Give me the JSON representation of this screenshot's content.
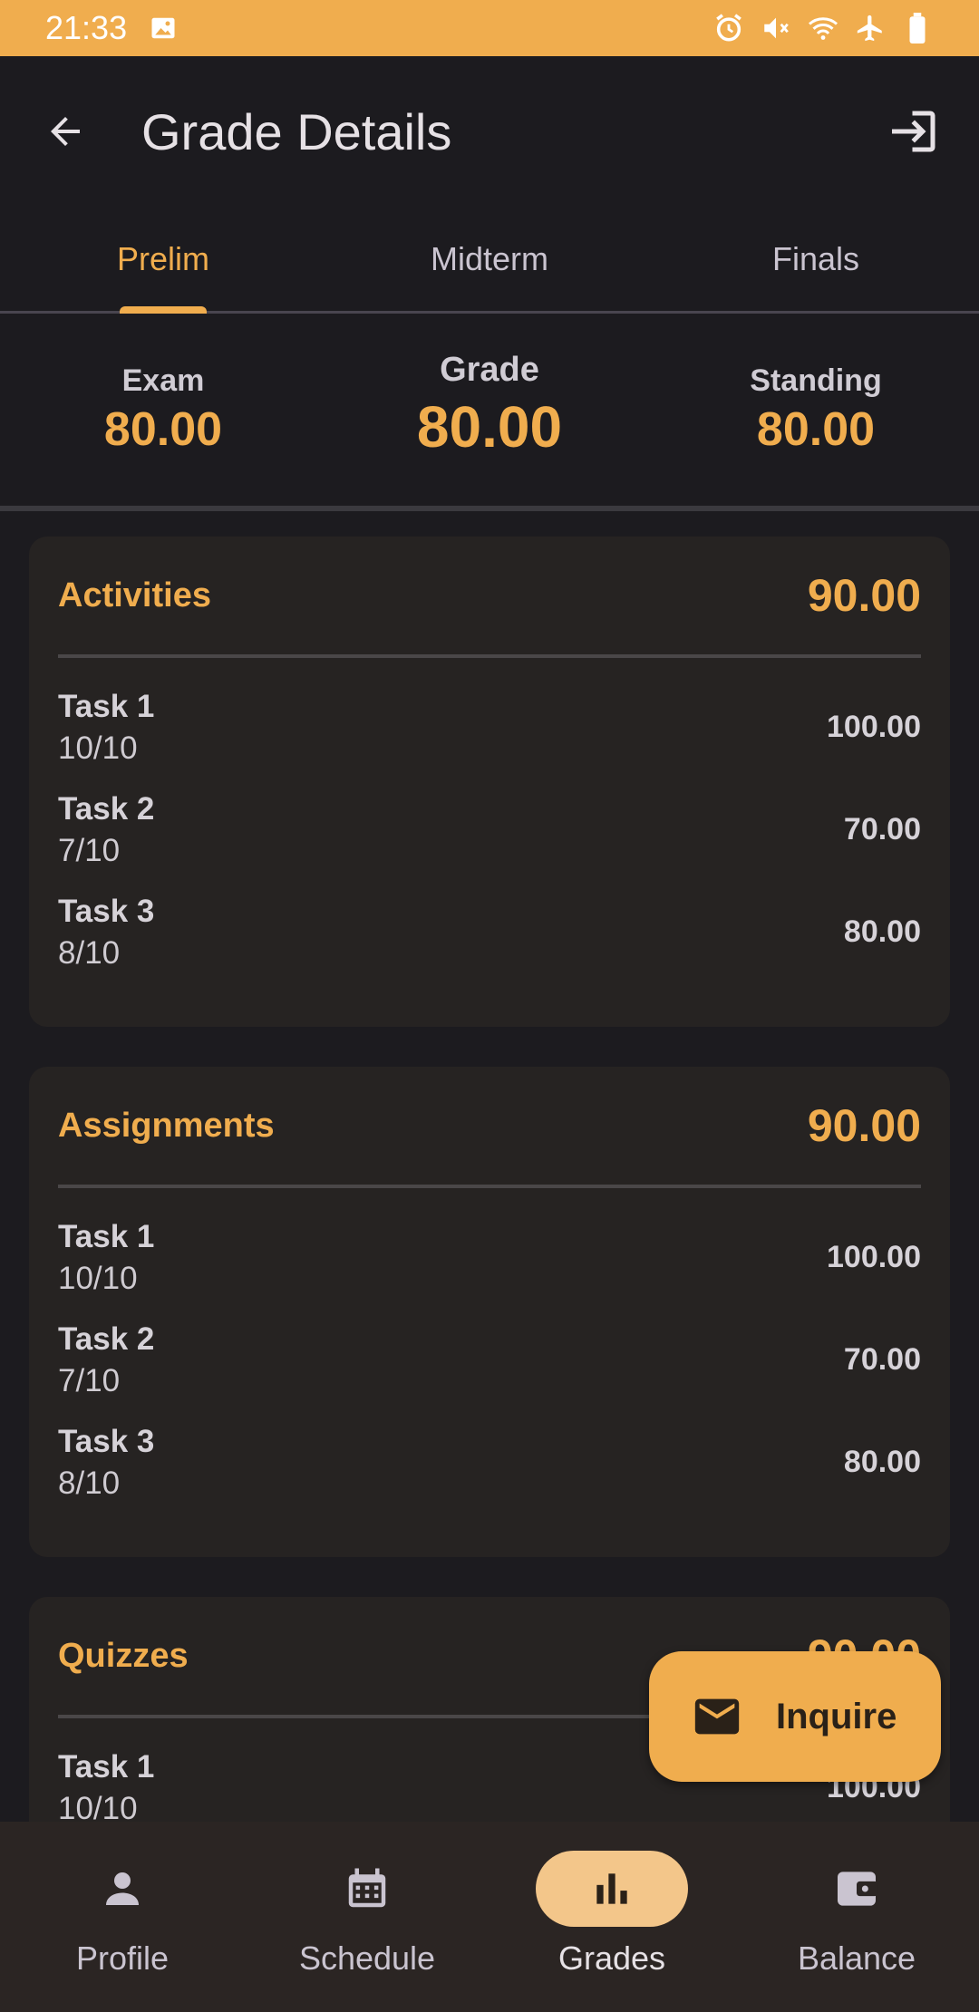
{
  "status_bar": {
    "time": "21:33",
    "left_icons": [
      "image-icon"
    ],
    "right_icons": [
      "alarm-icon",
      "mute-icon",
      "wifi-icon",
      "airplane-icon",
      "battery-icon"
    ]
  },
  "app_bar": {
    "title": "Grade Details",
    "back_icon": "arrow-back-icon",
    "logout_icon": "logout-icon"
  },
  "tabs": [
    {
      "label": "Prelim",
      "active": true
    },
    {
      "label": "Midterm",
      "active": false
    },
    {
      "label": "Finals",
      "active": false
    }
  ],
  "summary": {
    "exam": {
      "label": "Exam",
      "value": "80.00"
    },
    "grade": {
      "label": "Grade",
      "value": "80.00"
    },
    "standing": {
      "label": "Standing",
      "value": "80.00"
    }
  },
  "cards": [
    {
      "title": "Activities",
      "total": "90.00",
      "tasks": [
        {
          "name": "Task 1",
          "score": "10/10",
          "value": "100.00"
        },
        {
          "name": "Task 2",
          "score": "7/10",
          "value": "70.00"
        },
        {
          "name": "Task 3",
          "score": "8/10",
          "value": "80.00"
        }
      ]
    },
    {
      "title": "Assignments",
      "total": "90.00",
      "tasks": [
        {
          "name": "Task 1",
          "score": "10/10",
          "value": "100.00"
        },
        {
          "name": "Task 2",
          "score": "7/10",
          "value": "70.00"
        },
        {
          "name": "Task 3",
          "score": "8/10",
          "value": "80.00"
        }
      ]
    },
    {
      "title": "Quizzes",
      "total": "90.00",
      "tasks": [
        {
          "name": "Task 1",
          "score": "10/10",
          "value": "100.00"
        }
      ]
    }
  ],
  "fab": {
    "label": "Inquire",
    "icon": "mail-icon"
  },
  "bottom_nav": [
    {
      "label": "Profile",
      "icon": "person-icon",
      "active": false
    },
    {
      "label": "Schedule",
      "icon": "calendar-icon",
      "active": false
    },
    {
      "label": "Grades",
      "icon": "bar-chart-icon",
      "active": true
    },
    {
      "label": "Balance",
      "icon": "wallet-icon",
      "active": false
    }
  ],
  "colors": {
    "accent": "#f0ad4e",
    "background": "#1c1b1f",
    "card": "#262322",
    "nav_background": "#2b2523",
    "nav_active_pill": "#f3c68a"
  }
}
